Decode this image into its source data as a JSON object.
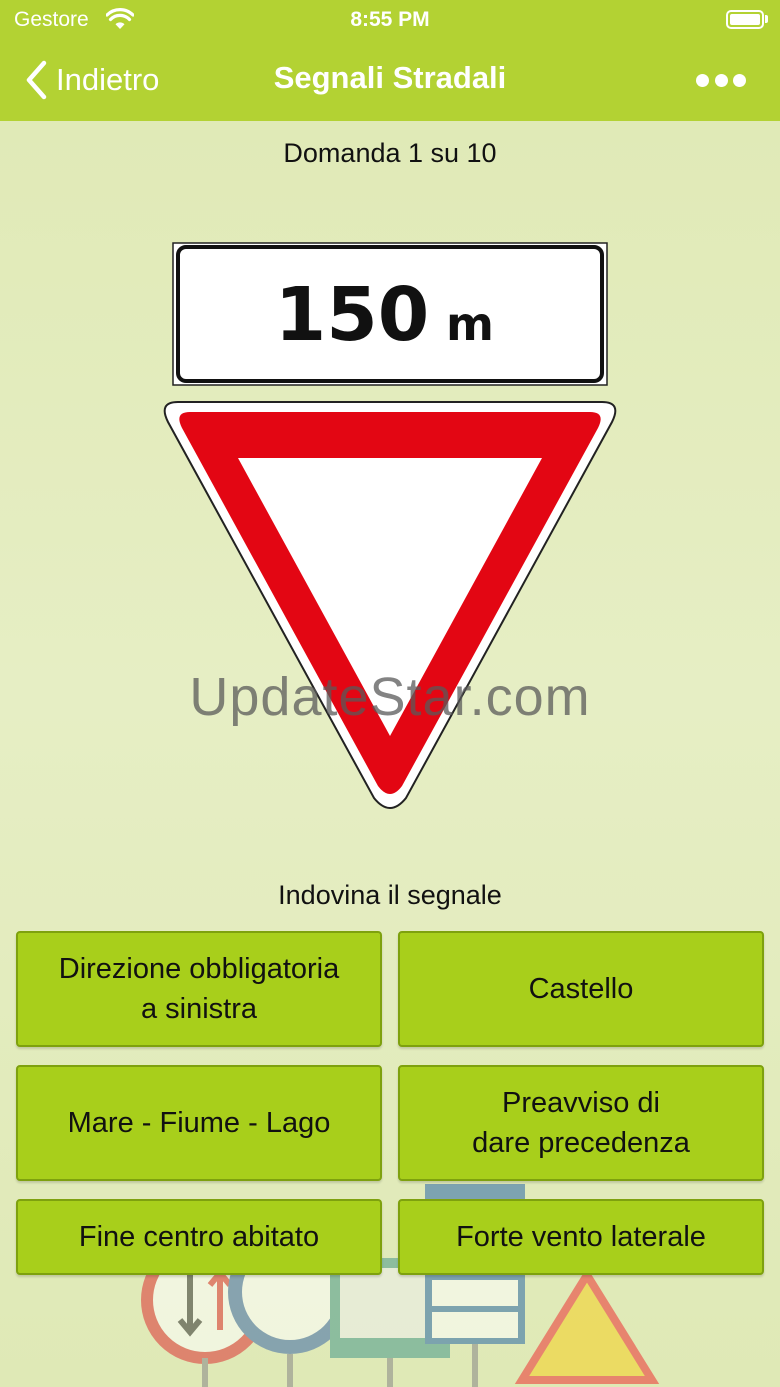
{
  "status_bar": {
    "carrier": "Gestore",
    "time": "8:55 PM"
  },
  "nav": {
    "back_label": "Indietro",
    "title": "Segnali Stradali"
  },
  "quiz": {
    "counter": "Domanda 1 su 10",
    "prompt": "Indovina il segnale",
    "sign_plate_number": "150",
    "sign_plate_unit": "m",
    "answers": [
      "Direzione obbligatoria\na sinistra",
      "Castello",
      "Mare - Fiume - Lago",
      "Preavviso di\ndare precedenza",
      "Fine centro abitato",
      "Forte vento laterale"
    ]
  },
  "watermark": "UpdateStar.com",
  "colors": {
    "nav_bar": "#b3d233",
    "answer_button": "#a8cf1b",
    "sign_red": "#e30613"
  }
}
